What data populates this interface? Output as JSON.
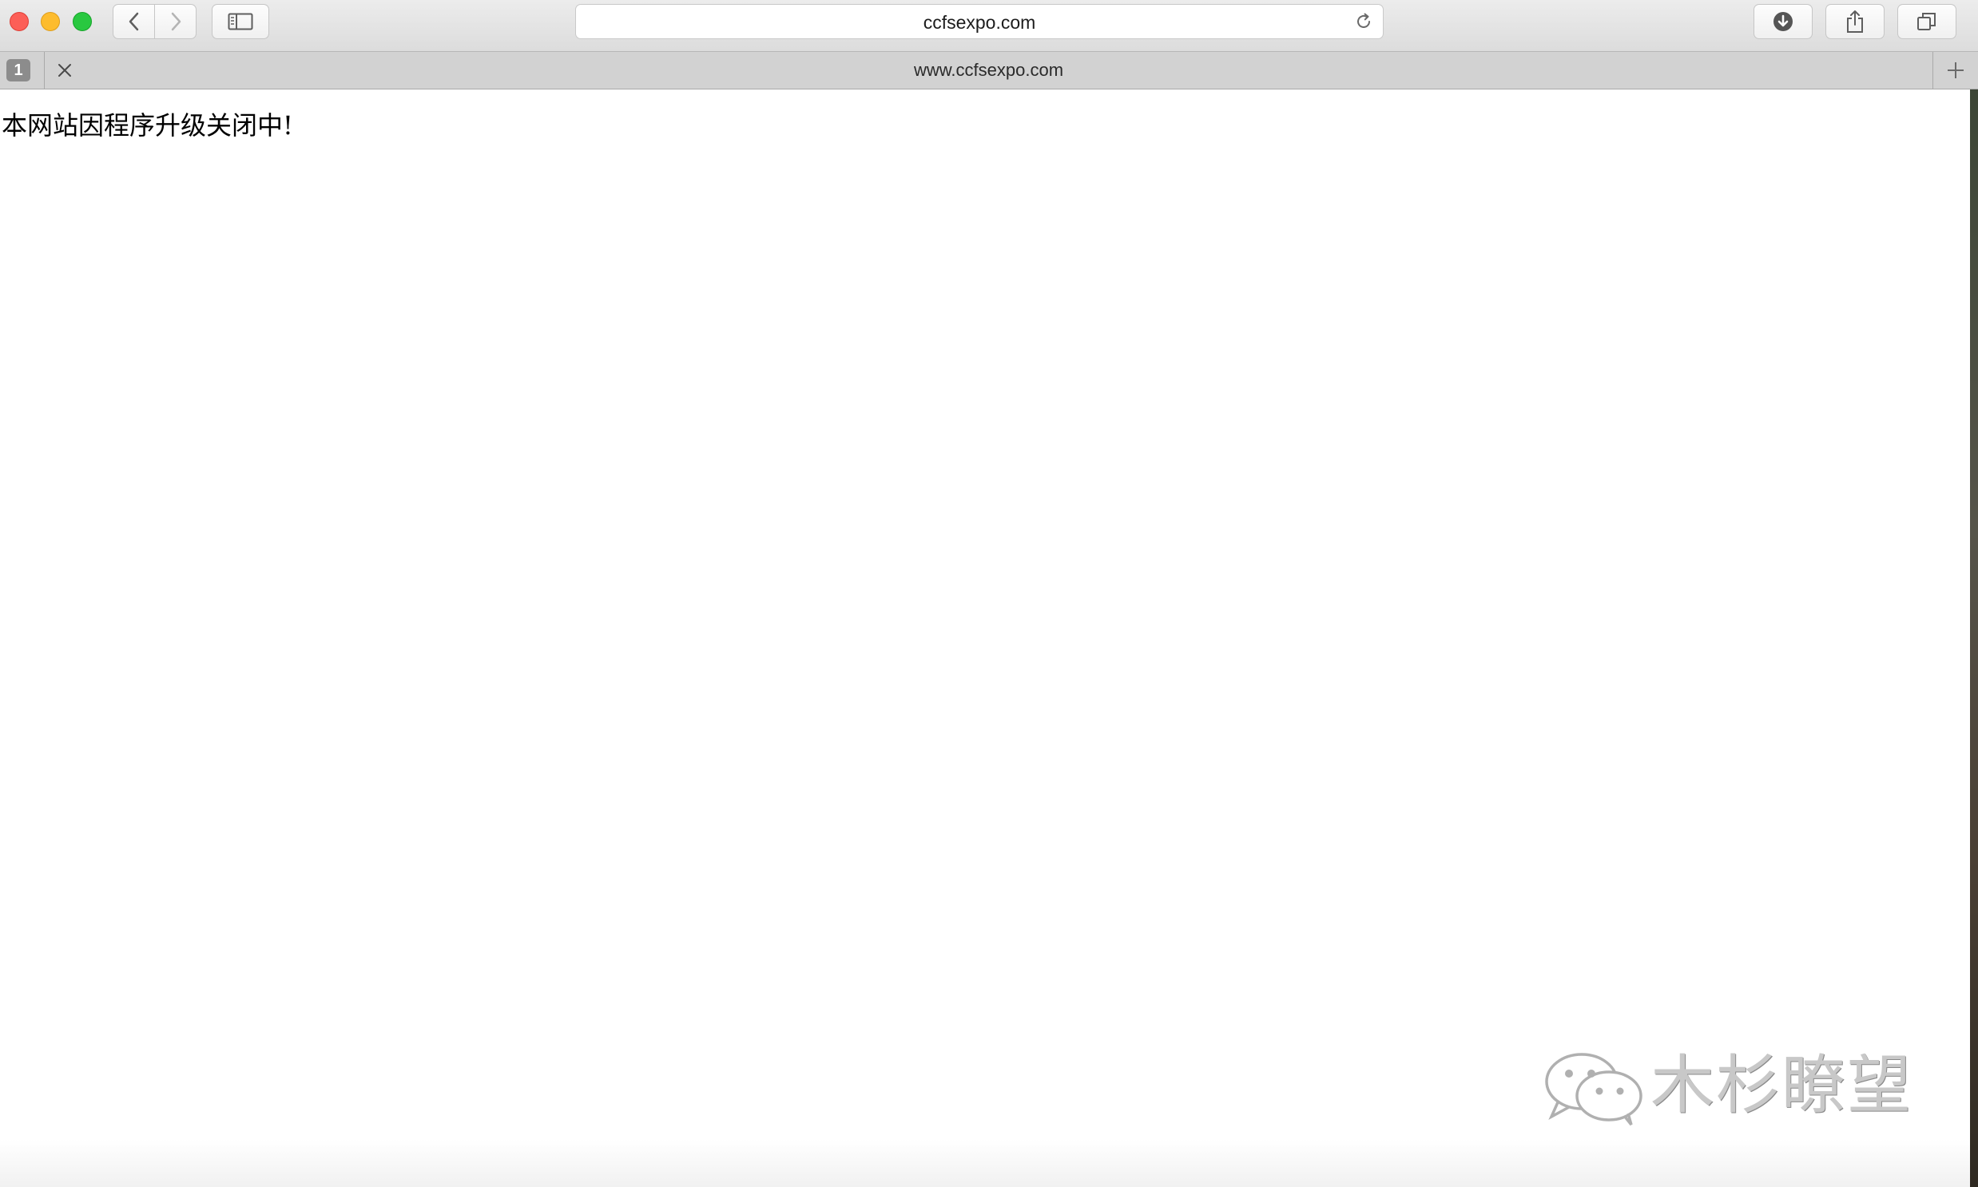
{
  "window": {
    "controls": [
      "close",
      "minimize",
      "zoom"
    ]
  },
  "toolbar": {
    "back_icon": "chevron-left-icon",
    "forward_icon": "chevron-right-icon",
    "sidebar_icon": "sidebar-icon",
    "downloads_icon": "download-icon",
    "share_icon": "share-icon",
    "tabs_icon": "tab-overview-icon"
  },
  "address_bar": {
    "url": "ccfsexpo.com",
    "reload_icon": "reload-icon"
  },
  "tab_bar": {
    "tab_count": "1",
    "tab_title": "www.ccfsexpo.com",
    "close_icon": "close-icon",
    "new_tab_icon": "plus-icon"
  },
  "page": {
    "message": "本网站因程序升级关闭中!"
  },
  "watermark": {
    "text": "木杉瞭望",
    "icon": "wechat-icon"
  }
}
